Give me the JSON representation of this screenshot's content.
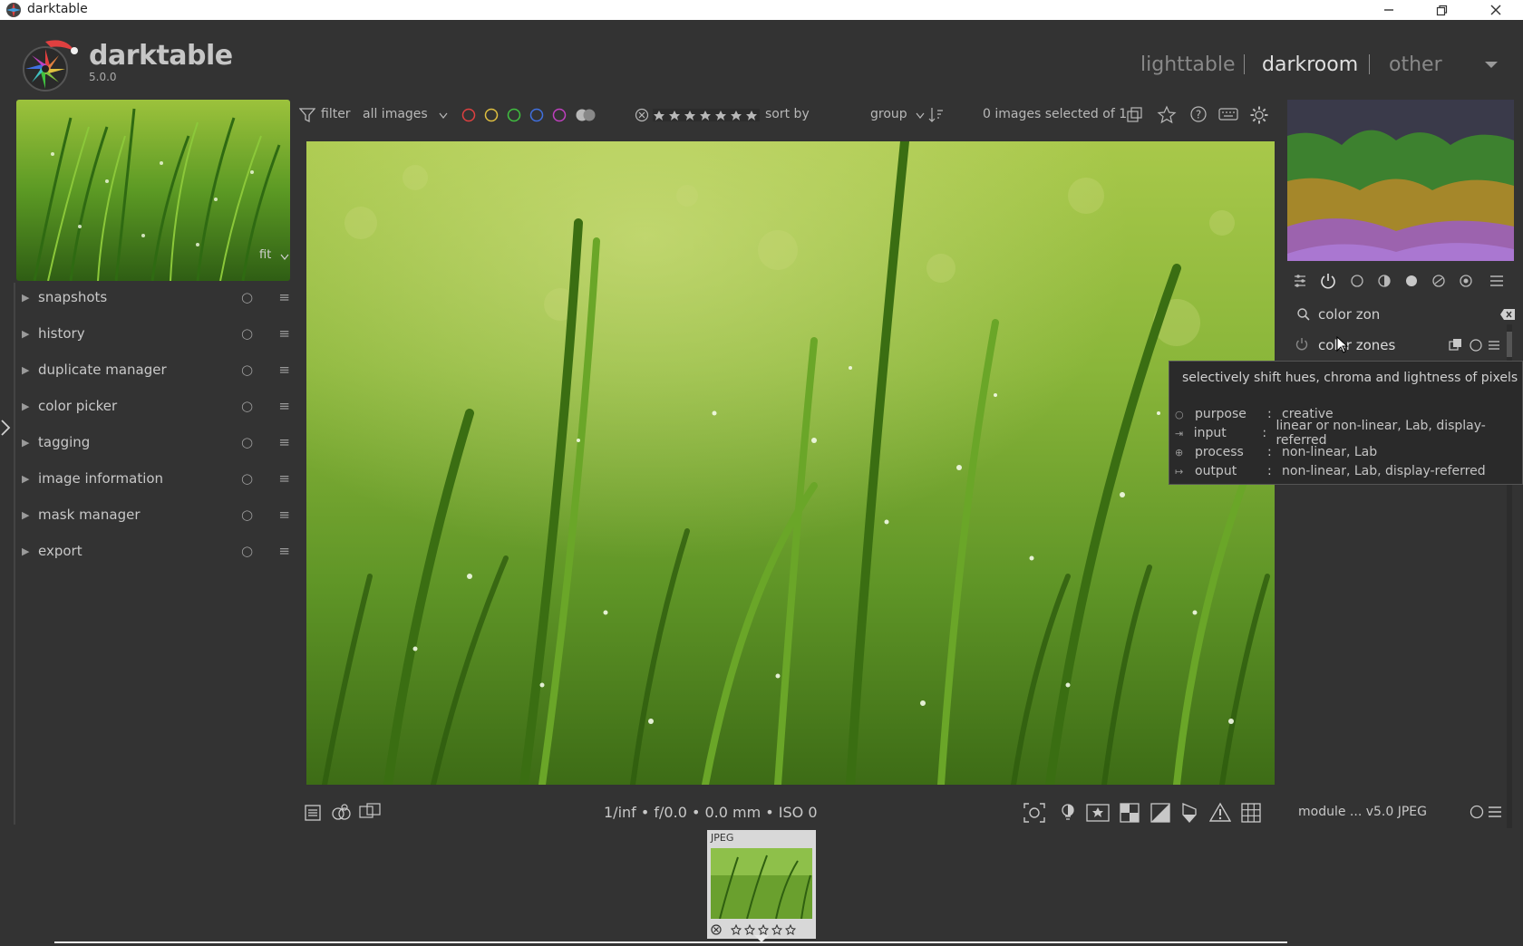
{
  "window": {
    "title": "darktable",
    "minimize_label": "—",
    "restore_label": "❐",
    "close_label": "✕"
  },
  "brand": {
    "name": "darktable",
    "version": "5.0.0"
  },
  "views": {
    "lighttable": "lighttable",
    "darkroom": "darkroom",
    "other": "other"
  },
  "toolbar": {
    "filter_label": "filter",
    "filter_value": "all images",
    "sort_label": "sort by",
    "sort_value": "group",
    "selection_status": "0 images selected of 1"
  },
  "left_panel": {
    "thumb_zoom": "fit",
    "modules": [
      {
        "label": "snapshots"
      },
      {
        "label": "history"
      },
      {
        "label": "duplicate manager"
      },
      {
        "label": "color picker"
      },
      {
        "label": "tagging"
      },
      {
        "label": "image information"
      },
      {
        "label": "mask manager"
      },
      {
        "label": "export"
      }
    ]
  },
  "right_panel": {
    "module_groups": [
      "quick-access-panel-icon",
      "active-modules-icon",
      "base-group-icon",
      "tone-group-icon",
      "color-group-icon",
      "correct-group-icon",
      "effect-group-icon",
      "presets-icon"
    ],
    "search_value": "color zon",
    "result_module": "color zones",
    "module_info": "module ... v5.0 JPEG"
  },
  "tooltip": {
    "description": "selectively shift hues, chroma and lightness of pixels",
    "rows": [
      {
        "key": "purpose",
        "value": "creative"
      },
      {
        "key": "input",
        "value": "linear or non-linear, Lab, display-referred"
      },
      {
        "key": "process",
        "value": "non-linear, Lab"
      },
      {
        "key": "output",
        "value": "non-linear, Lab, display-referred"
      }
    ]
  },
  "bottom": {
    "exif": "1/inf • f/0.0 • 0.0 mm • ISO 0",
    "filmstrip_format": "JPEG"
  },
  "colors": {
    "background": "#333333",
    "panel_text": "#c8c8c8",
    "reject_red": "#e04040",
    "label_colors": [
      "#e04040",
      "#e0c040",
      "#40c040",
      "#4070e0",
      "#c040c0"
    ]
  }
}
